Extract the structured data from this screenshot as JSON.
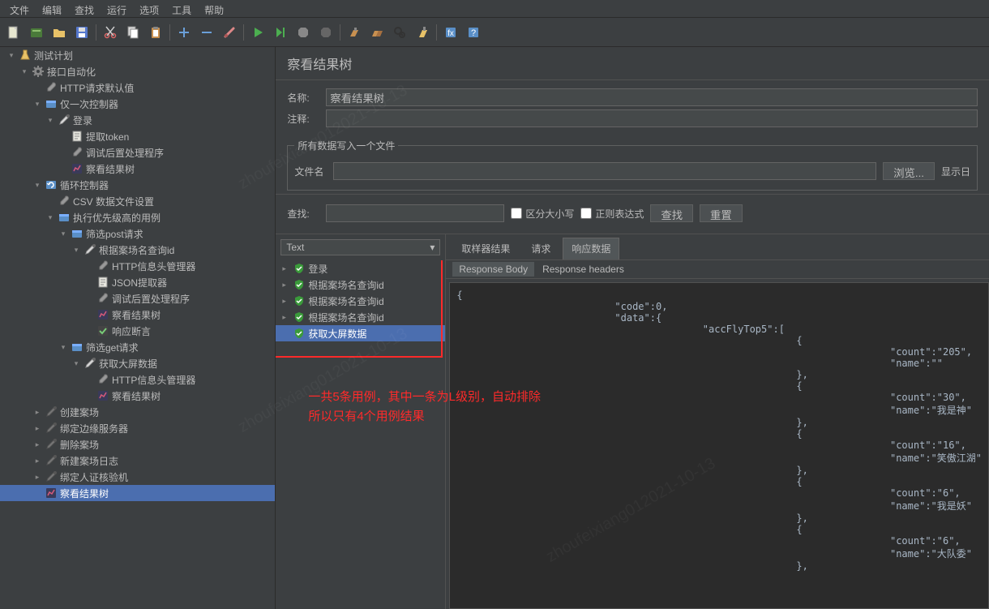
{
  "menu": [
    "文件",
    "编辑",
    "查找",
    "运行",
    "选项",
    "工具",
    "帮助"
  ],
  "tree": [
    {
      "indent": 0,
      "exp": "v",
      "icon": "flask",
      "label": "测试计划"
    },
    {
      "indent": 1,
      "exp": "v",
      "icon": "gear",
      "label": "接口自动化"
    },
    {
      "indent": 2,
      "exp": "",
      "icon": "wrench",
      "label": "HTTP请求默认值"
    },
    {
      "indent": 2,
      "exp": "v",
      "icon": "box",
      "label": "仅一次控制器"
    },
    {
      "indent": 3,
      "exp": "v",
      "icon": "dropper",
      "label": "登录"
    },
    {
      "indent": 4,
      "exp": "",
      "icon": "doc",
      "label": "提取token"
    },
    {
      "indent": 4,
      "exp": "",
      "icon": "wrench",
      "label": "调试后置处理程序"
    },
    {
      "indent": 4,
      "exp": "",
      "icon": "chart",
      "label": "察看结果树"
    },
    {
      "indent": 2,
      "exp": "v",
      "icon": "loop",
      "label": "循环控制器"
    },
    {
      "indent": 3,
      "exp": "",
      "icon": "wrench",
      "label": "CSV 数据文件设置"
    },
    {
      "indent": 3,
      "exp": "v",
      "icon": "box",
      "label": "执行优先级高的用例"
    },
    {
      "indent": 4,
      "exp": "v",
      "icon": "box",
      "label": "筛选post请求"
    },
    {
      "indent": 5,
      "exp": "v",
      "icon": "dropper",
      "label": "根据案场名查询id"
    },
    {
      "indent": 6,
      "exp": "",
      "icon": "wrench",
      "label": "HTTP信息头管理器"
    },
    {
      "indent": 6,
      "exp": "",
      "icon": "doc",
      "label": "JSON提取器"
    },
    {
      "indent": 6,
      "exp": "",
      "icon": "wrench",
      "label": "调试后置处理程序"
    },
    {
      "indent": 6,
      "exp": "",
      "icon": "chart",
      "label": "察看结果树"
    },
    {
      "indent": 6,
      "exp": "",
      "icon": "check",
      "label": "响应断言"
    },
    {
      "indent": 4,
      "exp": "v",
      "icon": "box",
      "label": "筛选get请求"
    },
    {
      "indent": 5,
      "exp": "v",
      "icon": "dropper",
      "label": "获取大屏数据"
    },
    {
      "indent": 6,
      "exp": "",
      "icon": "wrench",
      "label": "HTTP信息头管理器"
    },
    {
      "indent": 6,
      "exp": "",
      "icon": "chart",
      "label": "察看结果树"
    },
    {
      "indent": 2,
      "exp": ">",
      "icon": "dropper-dis",
      "label": "创建案场"
    },
    {
      "indent": 2,
      "exp": ">",
      "icon": "dropper-dis",
      "label": "绑定边缘服务器"
    },
    {
      "indent": 2,
      "exp": ">",
      "icon": "dropper-dis",
      "label": "删除案场"
    },
    {
      "indent": 2,
      "exp": ">",
      "icon": "dropper-dis",
      "label": "新建案场日志"
    },
    {
      "indent": 2,
      "exp": ">",
      "icon": "dropper-dis",
      "label": "绑定人证核验机"
    },
    {
      "indent": 2,
      "exp": "",
      "icon": "chart",
      "label": "察看结果树",
      "selected": true
    }
  ],
  "panel": {
    "title": "察看结果树",
    "nameLabel": "名称:",
    "nameValue": "察看结果树",
    "commentLabel": "注释:",
    "fileLegend": "所有数据写入一个文件",
    "fileNameLabel": "文件名",
    "browseBtn": "浏览...",
    "showLog": "显示日",
    "searchLabel": "查找:",
    "caseSensitive": "区分大小写",
    "regex": "正则表达式",
    "searchBtn": "查找",
    "resetBtn": "重置",
    "dropdown": "Text"
  },
  "results": [
    {
      "label": "登录",
      "exp": ">"
    },
    {
      "label": "根据案场名查询id",
      "exp": ">"
    },
    {
      "label": "根据案场名查询id",
      "exp": ">"
    },
    {
      "label": "根据案场名查询id",
      "exp": ">"
    },
    {
      "label": "获取大屏数据",
      "exp": "",
      "selected": true
    }
  ],
  "tabs": {
    "sampler": "取样器结果",
    "request": "请求",
    "response": "响应数据"
  },
  "subtabs": {
    "body": "Response Body",
    "headers": "Response headers"
  },
  "responseBody": "{\n                           \"code\":0,\n                           \"data\":{\n                                          \"accFlyTop5\":[\n                                                          {\n                                                                          \"count\":\"205\",\n                                                                          \"name\":\"\"\n                                                          },\n                                                          {\n                                                                          \"count\":\"30\",\n                                                                          \"name\":\"我是神\"\n                                                          },\n                                                          {\n                                                                          \"count\":\"16\",\n                                                                          \"name\":\"笑傲江湖\"\n                                                          },\n                                                          {\n                                                                          \"count\":\"6\",\n                                                                          \"name\":\"我是妖\"\n                                                          },\n                                                          {\n                                                                          \"count\":\"6\",\n                                                                          \"name\":\"大队委\"\n                                                          },",
  "annotation": "一共5条用例，其中一条为L级别，自动排除\n所以只有4个用例结果",
  "watermark": "zhoufeixiang012021-10-13"
}
